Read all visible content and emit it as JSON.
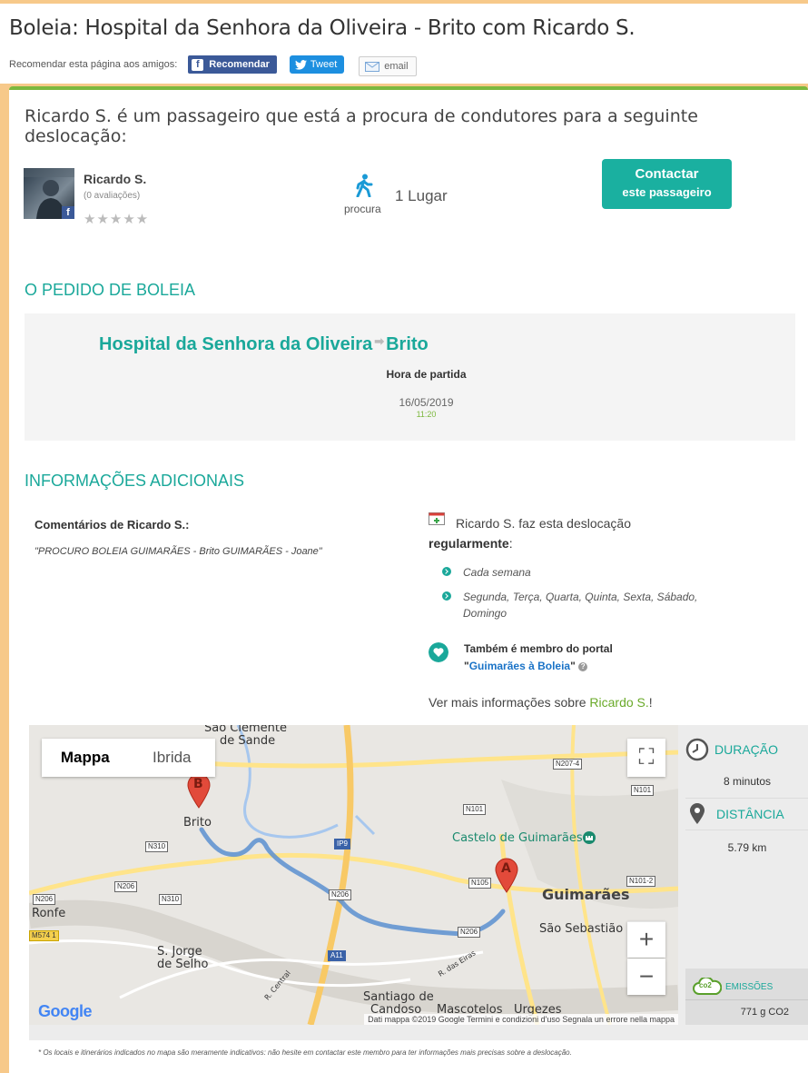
{
  "header": {
    "title": "Boleia: Hospital da Senhora da Oliveira - Brito com Ricardo S.",
    "share_label": "Recomendar esta página aos amigos:",
    "fb_label": "Recomendar",
    "fb_glyph": "f",
    "tweet_label": "Tweet",
    "email_label": "email"
  },
  "intro": "Ricardo S. é um passageiro que está a procura de condutores para a seguinte deslocação:",
  "user": {
    "name": "Ricardo S.",
    "reviews": "(0 avaliações)",
    "stars": "★★★★★",
    "fb_badge": "f"
  },
  "seats": {
    "caption": "procura",
    "label": "1 Lugar"
  },
  "contact": {
    "line1": "Contactar",
    "line2": "este passageiro"
  },
  "request": {
    "heading": "O PEDIDO DE BOLEIA",
    "origin": "Hospital da Senhora da Oliveira",
    "arrow": "➡",
    "destination": "Brito",
    "departure_label": "Hora de partida",
    "date": "16/05/2019",
    "time": "11:20"
  },
  "info": {
    "heading": "INFORMAÇÕES ADICIONAIS",
    "comments_label": "Comentários de Ricardo S.:",
    "comments": "\"PROCURO BOLEIA GUIMARÃES - Brito GUIMARÃES - Joane\"",
    "regular_line1": "Ricardo S. faz esta deslocação",
    "regular_line2": "regularmente",
    "regular_colon": ":",
    "frequency": "Cada semana",
    "days": "Segunda, Terça, Quarta, Quinta, Sexta, Sábado, Domingo",
    "member_line1": "Também é membro do portal",
    "member_quote_open": "\"",
    "member_portal": "Guimarães à Boleia",
    "member_quote_close": "\"",
    "help_glyph": "?",
    "more_prefix": "Ver mais informações sobre ",
    "more_name": "Ricardo S.",
    "more_suffix": "!"
  },
  "map": {
    "tab_map": "Mappa",
    "tab_hybrid": "Ibrida",
    "zoom_in": "+",
    "zoom_out": "−",
    "fullscreen": "⛶",
    "marker_a": "A",
    "marker_b": "B",
    "logo": "Google",
    "attribution": "Dati mappa ©2019 Google    Termini e condizioni d'uso    Segnala un errore nella mappa",
    "places": {
      "sao_clemente": "São Clemente",
      "de_sande": "de Sande",
      "brito": "Brito",
      "ronfe": "Ronfe",
      "castelo": "Castelo de Guimarães",
      "guimaraes": "Guimarães",
      "sao_sebastiao": "São Sebastião",
      "sao_jorge": "S. Jorge",
      "de_selho": "de Selho",
      "santiago": "Santiago de",
      "candoso": "Candoso",
      "mascotelos": "Mascotelos",
      "urgezes": "Urgezes",
      "r_eiras": "R. das Eiras",
      "r_central": "R. Central"
    },
    "roads": {
      "n207_4": "N207-4",
      "n101a": "N101",
      "n101b": "N101",
      "n310a": "N310",
      "n310b": "N310",
      "ip9": "IP9",
      "n206a": "N206",
      "n206b": "N206",
      "n206c": "N206",
      "n206d": "N206",
      "n105": "N105",
      "n101_2": "N101-2",
      "a11": "A11",
      "m574": "M574 1"
    }
  },
  "stats": {
    "duration_label": "DURAÇÃO",
    "duration_value": "8 minutos",
    "distance_label": "DISTÂNCIA",
    "distance_value": "5.79 km",
    "emissions_label": "EMISSÕES",
    "emissions_value": "771 g CO2",
    "co2_glyph": "co2"
  },
  "footnote": "* Os locais e itinerários indicados no mapa são meramente indicativos: não hesite em contactar este membro para ter informações mais precisas sobre a deslocação.",
  "colors": {
    "accent": "#1aa89a",
    "green": "#7cb83e",
    "facebook": "#3b5998",
    "twitter": "#1d8fe0",
    "frame": "#f7c98a"
  }
}
